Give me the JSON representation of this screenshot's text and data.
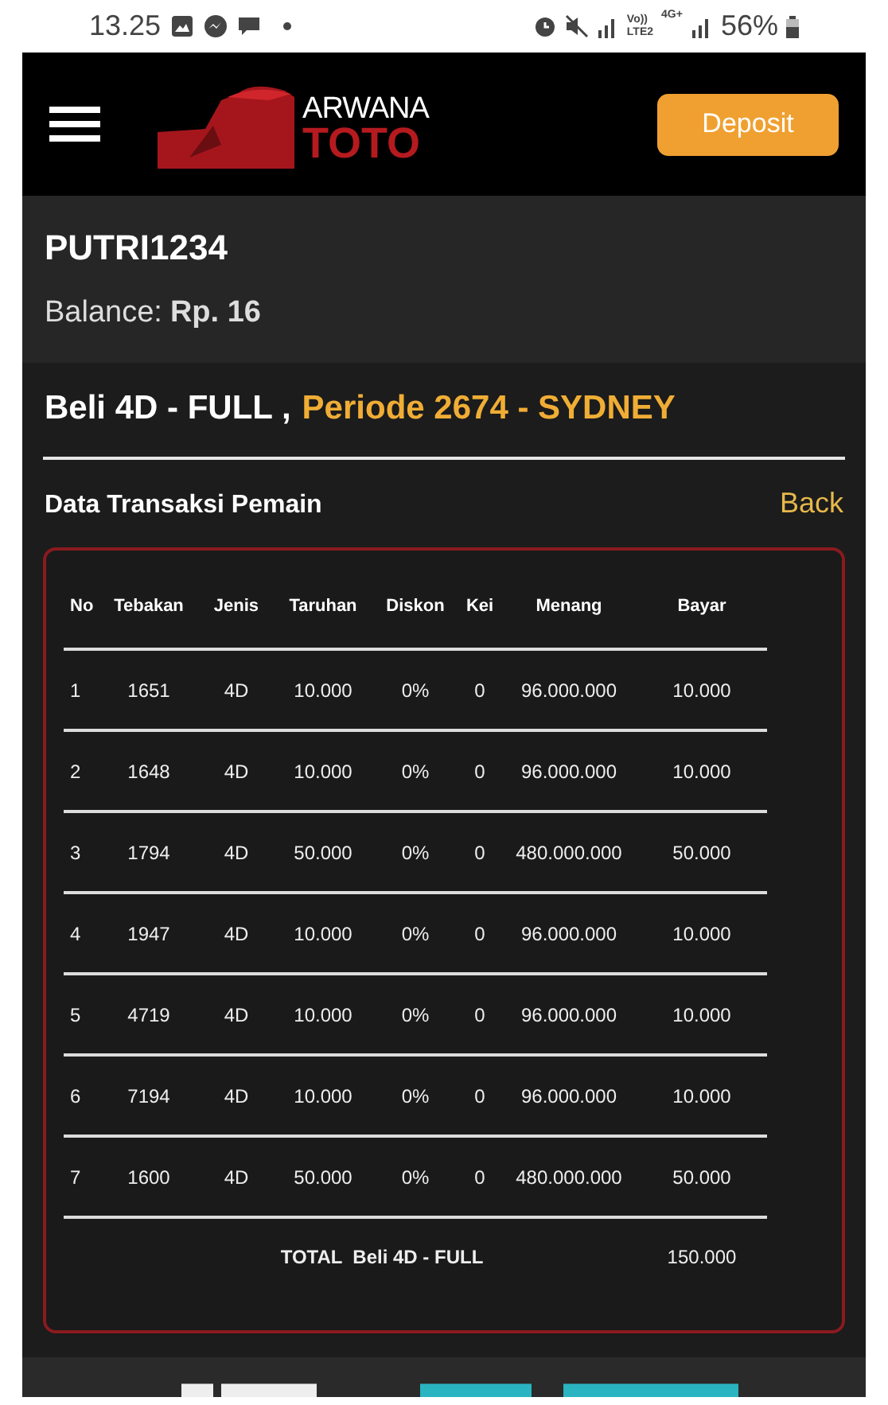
{
  "status_bar": {
    "time": "13.25",
    "network_volte": [
      "Vo))",
      "LTE2"
    ],
    "network_4g": "4G+",
    "battery": "56%"
  },
  "header": {
    "logo": {
      "top": "ARWANA",
      "bottom": "TOTO"
    },
    "deposit_button": "Deposit"
  },
  "profile": {
    "username": "PUTRI1234",
    "balance_label": "Balance:",
    "balance_value": "Rp. 16"
  },
  "page_title": {
    "main": "Beli 4D - FULL ,",
    "period": "Periode 2674 - SYDNEY"
  },
  "section": {
    "title": "Data Transaksi Pemain",
    "back_link": "Back"
  },
  "table": {
    "columns": [
      "No",
      "Tebakan",
      "Jenis",
      "Taruhan",
      "Diskon",
      "Kei",
      "Menang",
      "Bayar"
    ],
    "rows": [
      [
        "1",
        "1651",
        "4D",
        "10.000",
        "0%",
        "0",
        "96.000.000",
        "10.000"
      ],
      [
        "2",
        "1648",
        "4D",
        "10.000",
        "0%",
        "0",
        "96.000.000",
        "10.000"
      ],
      [
        "3",
        "1794",
        "4D",
        "50.000",
        "0%",
        "0",
        "480.000.000",
        "50.000"
      ],
      [
        "4",
        "1947",
        "4D",
        "10.000",
        "0%",
        "0",
        "96.000.000",
        "10.000"
      ],
      [
        "5",
        "4719",
        "4D",
        "10.000",
        "0%",
        "0",
        "96.000.000",
        "10.000"
      ],
      [
        "6",
        "7194",
        "4D",
        "10.000",
        "0%",
        "0",
        "96.000.000",
        "10.000"
      ],
      [
        "7",
        "1600",
        "4D",
        "50.000",
        "0%",
        "0",
        "480.000.000",
        "50.000"
      ]
    ],
    "total": {
      "label": "TOTAL  Beli 4D - FULL",
      "value": "150.000"
    }
  }
}
